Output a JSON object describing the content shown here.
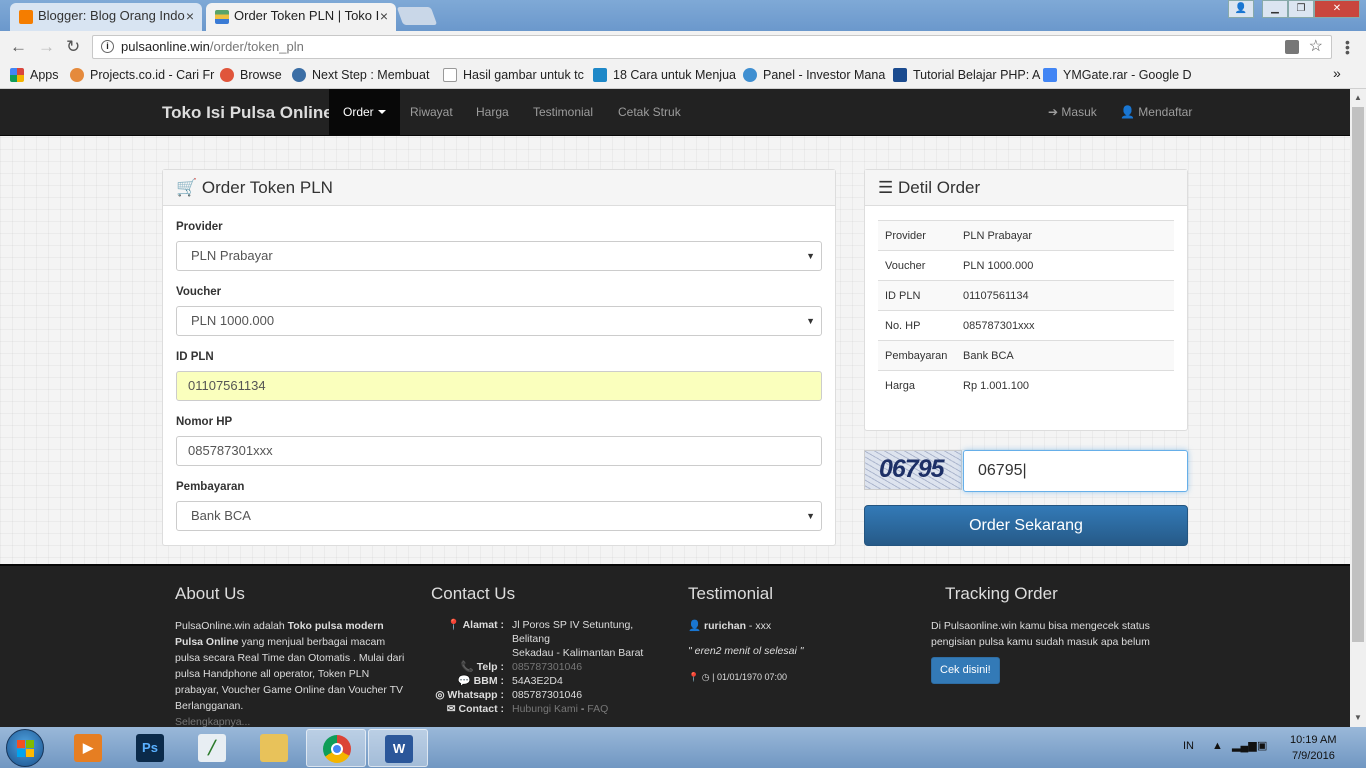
{
  "browser": {
    "tabs": [
      {
        "label": "Blogger: Blog Orang Indo",
        "close": "×",
        "favicon_color": "#f57d00"
      },
      {
        "label": "Order Token PLN | Toko I",
        "close": "×",
        "favicon_color": "#3a7bd5"
      }
    ],
    "url_host": "pulsaonline.win",
    "url_path": "/order/token_pln",
    "bookmarks": [
      {
        "label": "Apps",
        "color": "#d9463e"
      },
      {
        "label": "Projects.co.id - Cari Fr",
        "color": "#e58a3c"
      },
      {
        "label": "Browse",
        "color": "#e0553b"
      },
      {
        "label": "Next Step : Membuat",
        "color": "#3b6ea5"
      },
      {
        "label": "Hasil gambar untuk tc",
        "color": "#999999"
      },
      {
        "label": "18 Cara untuk Menjua",
        "color": "#1e88c8"
      },
      {
        "label": "Panel - Investor Mana",
        "color": "#3f8fd1"
      },
      {
        "label": "Tutorial Belajar PHP: A",
        "color": "#1b4b8f"
      },
      {
        "label": "YMGate.rar - Google D",
        "color": "#4285f4"
      }
    ],
    "more": "»"
  },
  "navbar": {
    "brand": "Toko Isi Pulsa Online",
    "links": [
      "Order",
      "Riwayat",
      "Harga",
      "Testimonial",
      "Cetak Struk"
    ],
    "login": "Masuk",
    "register": "Mendaftar"
  },
  "order_form": {
    "title": "Order Token PLN",
    "provider_label": "Provider",
    "provider_value": "PLN Prabayar",
    "voucher_label": "Voucher",
    "voucher_value": "PLN 1000.000",
    "idpln_label": "ID PLN",
    "idpln_value": "01107561134",
    "hp_label": "Nomor HP",
    "hp_value": "085787301xxx",
    "payment_label": "Pembayaran",
    "payment_value": "Bank BCA"
  },
  "detail": {
    "title": "Detil Order",
    "rows": [
      {
        "k": "Provider",
        "v": "PLN Prabayar"
      },
      {
        "k": "Voucher",
        "v": "PLN 1000.000"
      },
      {
        "k": "ID PLN",
        "v": "01107561134"
      },
      {
        "k": "No. HP",
        "v": "085787301xxx"
      },
      {
        "k": "Pembayaran",
        "v": "Bank BCA"
      },
      {
        "k": "Harga",
        "v": "Rp 1.001.100"
      }
    ]
  },
  "captcha": {
    "image_text": "06795",
    "input_value": "06795"
  },
  "order_button": "Order Sekarang",
  "footer": {
    "about_title": "About Us",
    "about_1": "PulsaOnline.win adalah ",
    "about_bold": "Toko pulsa modern Pulsa Online",
    "about_2": " yang menjual berbagai macam pulsa secara Real Time dan Otomatis . Mulai dari pulsa Handphone all operator, Token PLN prabayar, Voucher Game Online dan Voucher TV Berlangganan.",
    "about_more": "Selengkapnya...",
    "contact_title": "Contact Us",
    "alamat_k": "Alamat :",
    "alamat_1": "Jl Poros SP IV Setuntung,",
    "alamat_2": "Belitang",
    "alamat_3": "Sekadau - Kalimantan Barat",
    "telp_k": "Telp :",
    "telp_v": "085787301046",
    "bbm_k": "BBM :",
    "bbm_v": "54A3E2D4",
    "wa_k": "Whatsapp :",
    "wa_v": "085787301046",
    "contact_k": "Contact :",
    "contact_link1": "Hubungi Kami",
    "contact_sep": " - ",
    "contact_link2": "FAQ",
    "testi_title": "Testimonial",
    "testi_user": "rurichan",
    "testi_user_sep": " - xxx",
    "testi_quote": "\" eren2 menit ol selesai \"",
    "testi_meta": "| 01/01/1970 07:00",
    "track_title": "Tracking Order",
    "track_text": "Di Pulsaonline.win kamu bisa mengecek status pengisian pulsa kamu sudah masuk apa belum",
    "track_button": "Cek disini!"
  },
  "taskbar": {
    "lang": "IN",
    "time": "10:19 AM",
    "date": "7/9/2016"
  }
}
